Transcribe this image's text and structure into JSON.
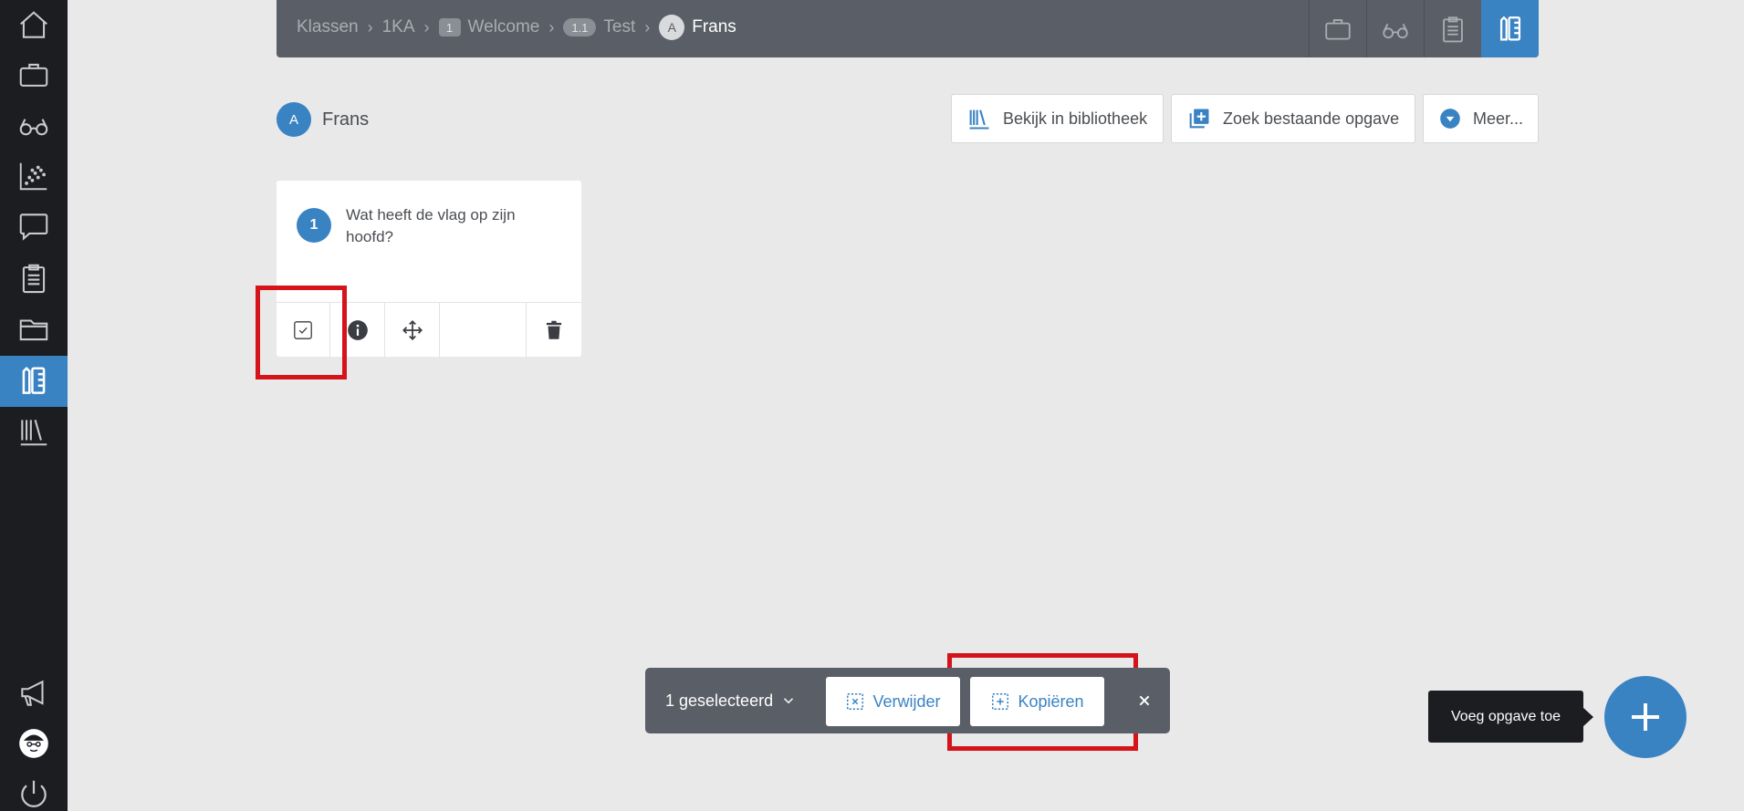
{
  "colors": {
    "accent": "#3a83c3",
    "sidebar_bg": "#1b1d21",
    "topbar_bg": "#5a5e66",
    "page_bg": "#e9e9e9",
    "highlight": "#d4141a"
  },
  "sidebar": {
    "items": [
      {
        "icon": "home-icon",
        "active": false
      },
      {
        "icon": "briefcase-icon",
        "active": false
      },
      {
        "icon": "glasses-icon",
        "active": false
      },
      {
        "icon": "scatter-chart-icon",
        "active": false
      },
      {
        "icon": "chat-icon",
        "active": false
      },
      {
        "icon": "clipboard-icon",
        "active": false
      },
      {
        "icon": "folder-icon",
        "active": false
      },
      {
        "icon": "exercise-editor-icon",
        "active": true
      },
      {
        "icon": "library-icon",
        "active": false
      }
    ],
    "bottom_items": [
      {
        "icon": "megaphone-icon"
      },
      {
        "icon": "user-face-icon"
      },
      {
        "icon": "power-icon"
      }
    ]
  },
  "breadcrumb": {
    "items": [
      {
        "label": "Klassen"
      },
      {
        "label": "1KA"
      },
      {
        "badge": "1",
        "label": "Welcome"
      },
      {
        "badge": "1.1",
        "label": "Test"
      },
      {
        "avatar": "A",
        "label": "Frans"
      }
    ]
  },
  "top_icons": [
    {
      "icon": "briefcase-icon",
      "active": false
    },
    {
      "icon": "glasses-icon",
      "active": false
    },
    {
      "icon": "clipboard-icon",
      "active": false
    },
    {
      "icon": "exercise-editor-icon",
      "active": true
    }
  ],
  "header": {
    "avatar_letter": "A",
    "name": "Frans",
    "buttons": {
      "library": "Bekijk in bibliotheek",
      "search_existing": "Zoek bestaande opgave",
      "more": "Meer..."
    }
  },
  "question": {
    "number": "1",
    "text": "Wat heeft de vlag op zijn hoofd?",
    "selected": true
  },
  "selection_bar": {
    "count_label": "1 geselecteerd",
    "delete_label": "Verwijder",
    "copy_label": "Kopiëren"
  },
  "fab": {
    "tooltip": "Voeg opgave toe"
  }
}
